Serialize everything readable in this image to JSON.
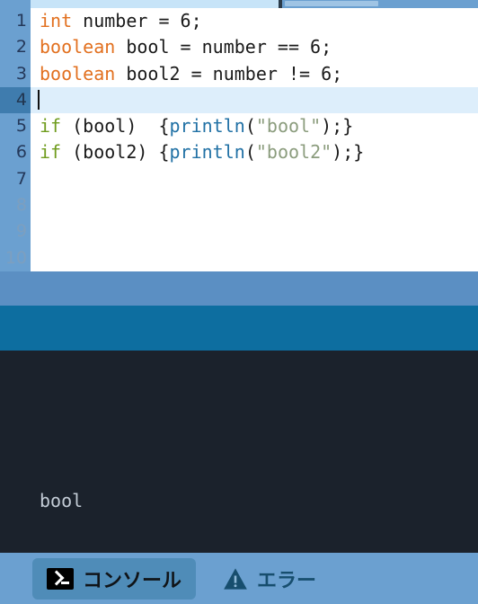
{
  "app": {
    "kind": "code-editor-with-console",
    "language": "java"
  },
  "scrollbar": {
    "horizontal_thumb": "h-scroll-thumb"
  },
  "editor": {
    "line_numbers": [
      "1",
      "2",
      "3",
      "4",
      "5",
      "6",
      "7",
      "8",
      "9",
      "10"
    ],
    "active_line": 4,
    "faded_from_line": 8,
    "lines": [
      {
        "n": "1",
        "tokens": [
          {
            "t": "int",
            "c": "kw-type"
          },
          {
            "t": " number = 6;",
            "c": "punct"
          }
        ]
      },
      {
        "n": "2",
        "tokens": [
          {
            "t": "boolean",
            "c": "kw-type"
          },
          {
            "t": " bool = number == 6;",
            "c": "punct"
          }
        ]
      },
      {
        "n": "3",
        "tokens": [
          {
            "t": "boolean",
            "c": "kw-type"
          },
          {
            "t": " bool2 = number != 6;",
            "c": "punct"
          }
        ]
      },
      {
        "n": "4",
        "tokens": []
      },
      {
        "n": "5",
        "tokens": [
          {
            "t": "if",
            "c": "kw-ctl"
          },
          {
            "t": " (bool)  {",
            "c": "punct"
          },
          {
            "t": "println",
            "c": "fn"
          },
          {
            "t": "(",
            "c": "punct"
          },
          {
            "t": "\"bool\"",
            "c": "str"
          },
          {
            "t": ");}",
            "c": "punct"
          }
        ]
      },
      {
        "n": "6",
        "tokens": [
          {
            "t": "if",
            "c": "kw-ctl"
          },
          {
            "t": " (bool2) {",
            "c": "punct"
          },
          {
            "t": "println",
            "c": "fn"
          },
          {
            "t": "(",
            "c": "punct"
          },
          {
            "t": "\"bool2\"",
            "c": "str"
          },
          {
            "t": ");}",
            "c": "punct"
          }
        ]
      },
      {
        "n": "7",
        "tokens": []
      },
      {
        "n": "8",
        "tokens": []
      },
      {
        "n": "9",
        "tokens": []
      },
      {
        "n": "10",
        "tokens": []
      }
    ]
  },
  "console": {
    "output": "bool"
  },
  "tabs": [
    {
      "id": "console",
      "label": "コンソール",
      "icon": "terminal-icon",
      "active": true
    },
    {
      "id": "error",
      "label": "エラー",
      "icon": "warning-triangle-icon",
      "active": false
    }
  ],
  "colors": {
    "gutter": "#6ba0d0",
    "gutter_active": "#3f7cae",
    "editor_bg": "#ffffff",
    "current_line": "#ddeefb",
    "band_light": "#5b8fc3",
    "band_teal": "#0d6ea0",
    "console_bg": "#1b222c",
    "console_text": "#c3ccd6",
    "tab_active_bg": "#4f8cb8",
    "type_keyword": "#e2701f",
    "control_keyword": "#6f9c1d",
    "function": "#2171a5",
    "string": "#8b9c7d",
    "top_rail": "#c7e4f8"
  }
}
